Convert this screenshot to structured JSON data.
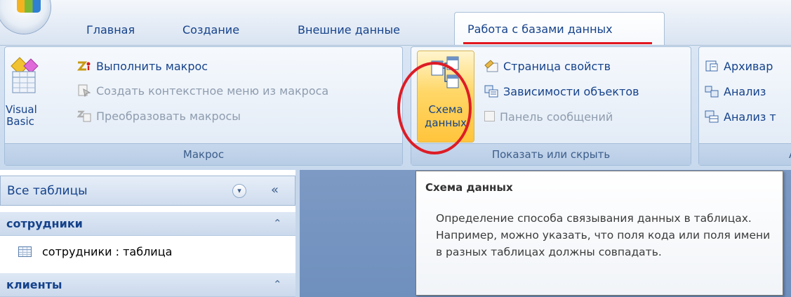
{
  "tabs": {
    "home": "Главная",
    "create": "Создание",
    "external": "Внешние данные",
    "database_tools": "Работа с базами данных"
  },
  "ribbon": {
    "macro_group": {
      "label": "Макрос",
      "visual_basic": "Visual Basic",
      "run_macro": "Выполнить макрос",
      "create_shortcut_menu": "Создать контекстное меню из макроса",
      "convert_macros": "Преобразовать макросы"
    },
    "show_hide_group": {
      "label": "Показать или скрыть",
      "schema_line1": "Схема",
      "schema_line2": "данных",
      "property_sheet": "Страница свойств",
      "object_dependencies": "Зависимости объектов",
      "message_bar": "Панель сообщений"
    },
    "analyze_group": {
      "label": "А",
      "archiver": "Архивар",
      "analyze_1": "Анализ",
      "analyze_2": "Анализ т"
    }
  },
  "navigation": {
    "title": "Все таблицы",
    "groups": [
      {
        "name": "сотрудники",
        "items": [
          "сотрудники : таблица"
        ]
      },
      {
        "name": "клиенты",
        "items": []
      }
    ]
  },
  "tooltip": {
    "title": "Схема данных",
    "body": "Определение способа связывания данных в таблицах. Например, можно указать, что поля кода или поля имени в разных таблицах должны совпадать."
  },
  "colors": {
    "highlight_annotation": "#dd1c26",
    "selected_button": "#ffd767",
    "workspace": "#7d9ac4"
  }
}
